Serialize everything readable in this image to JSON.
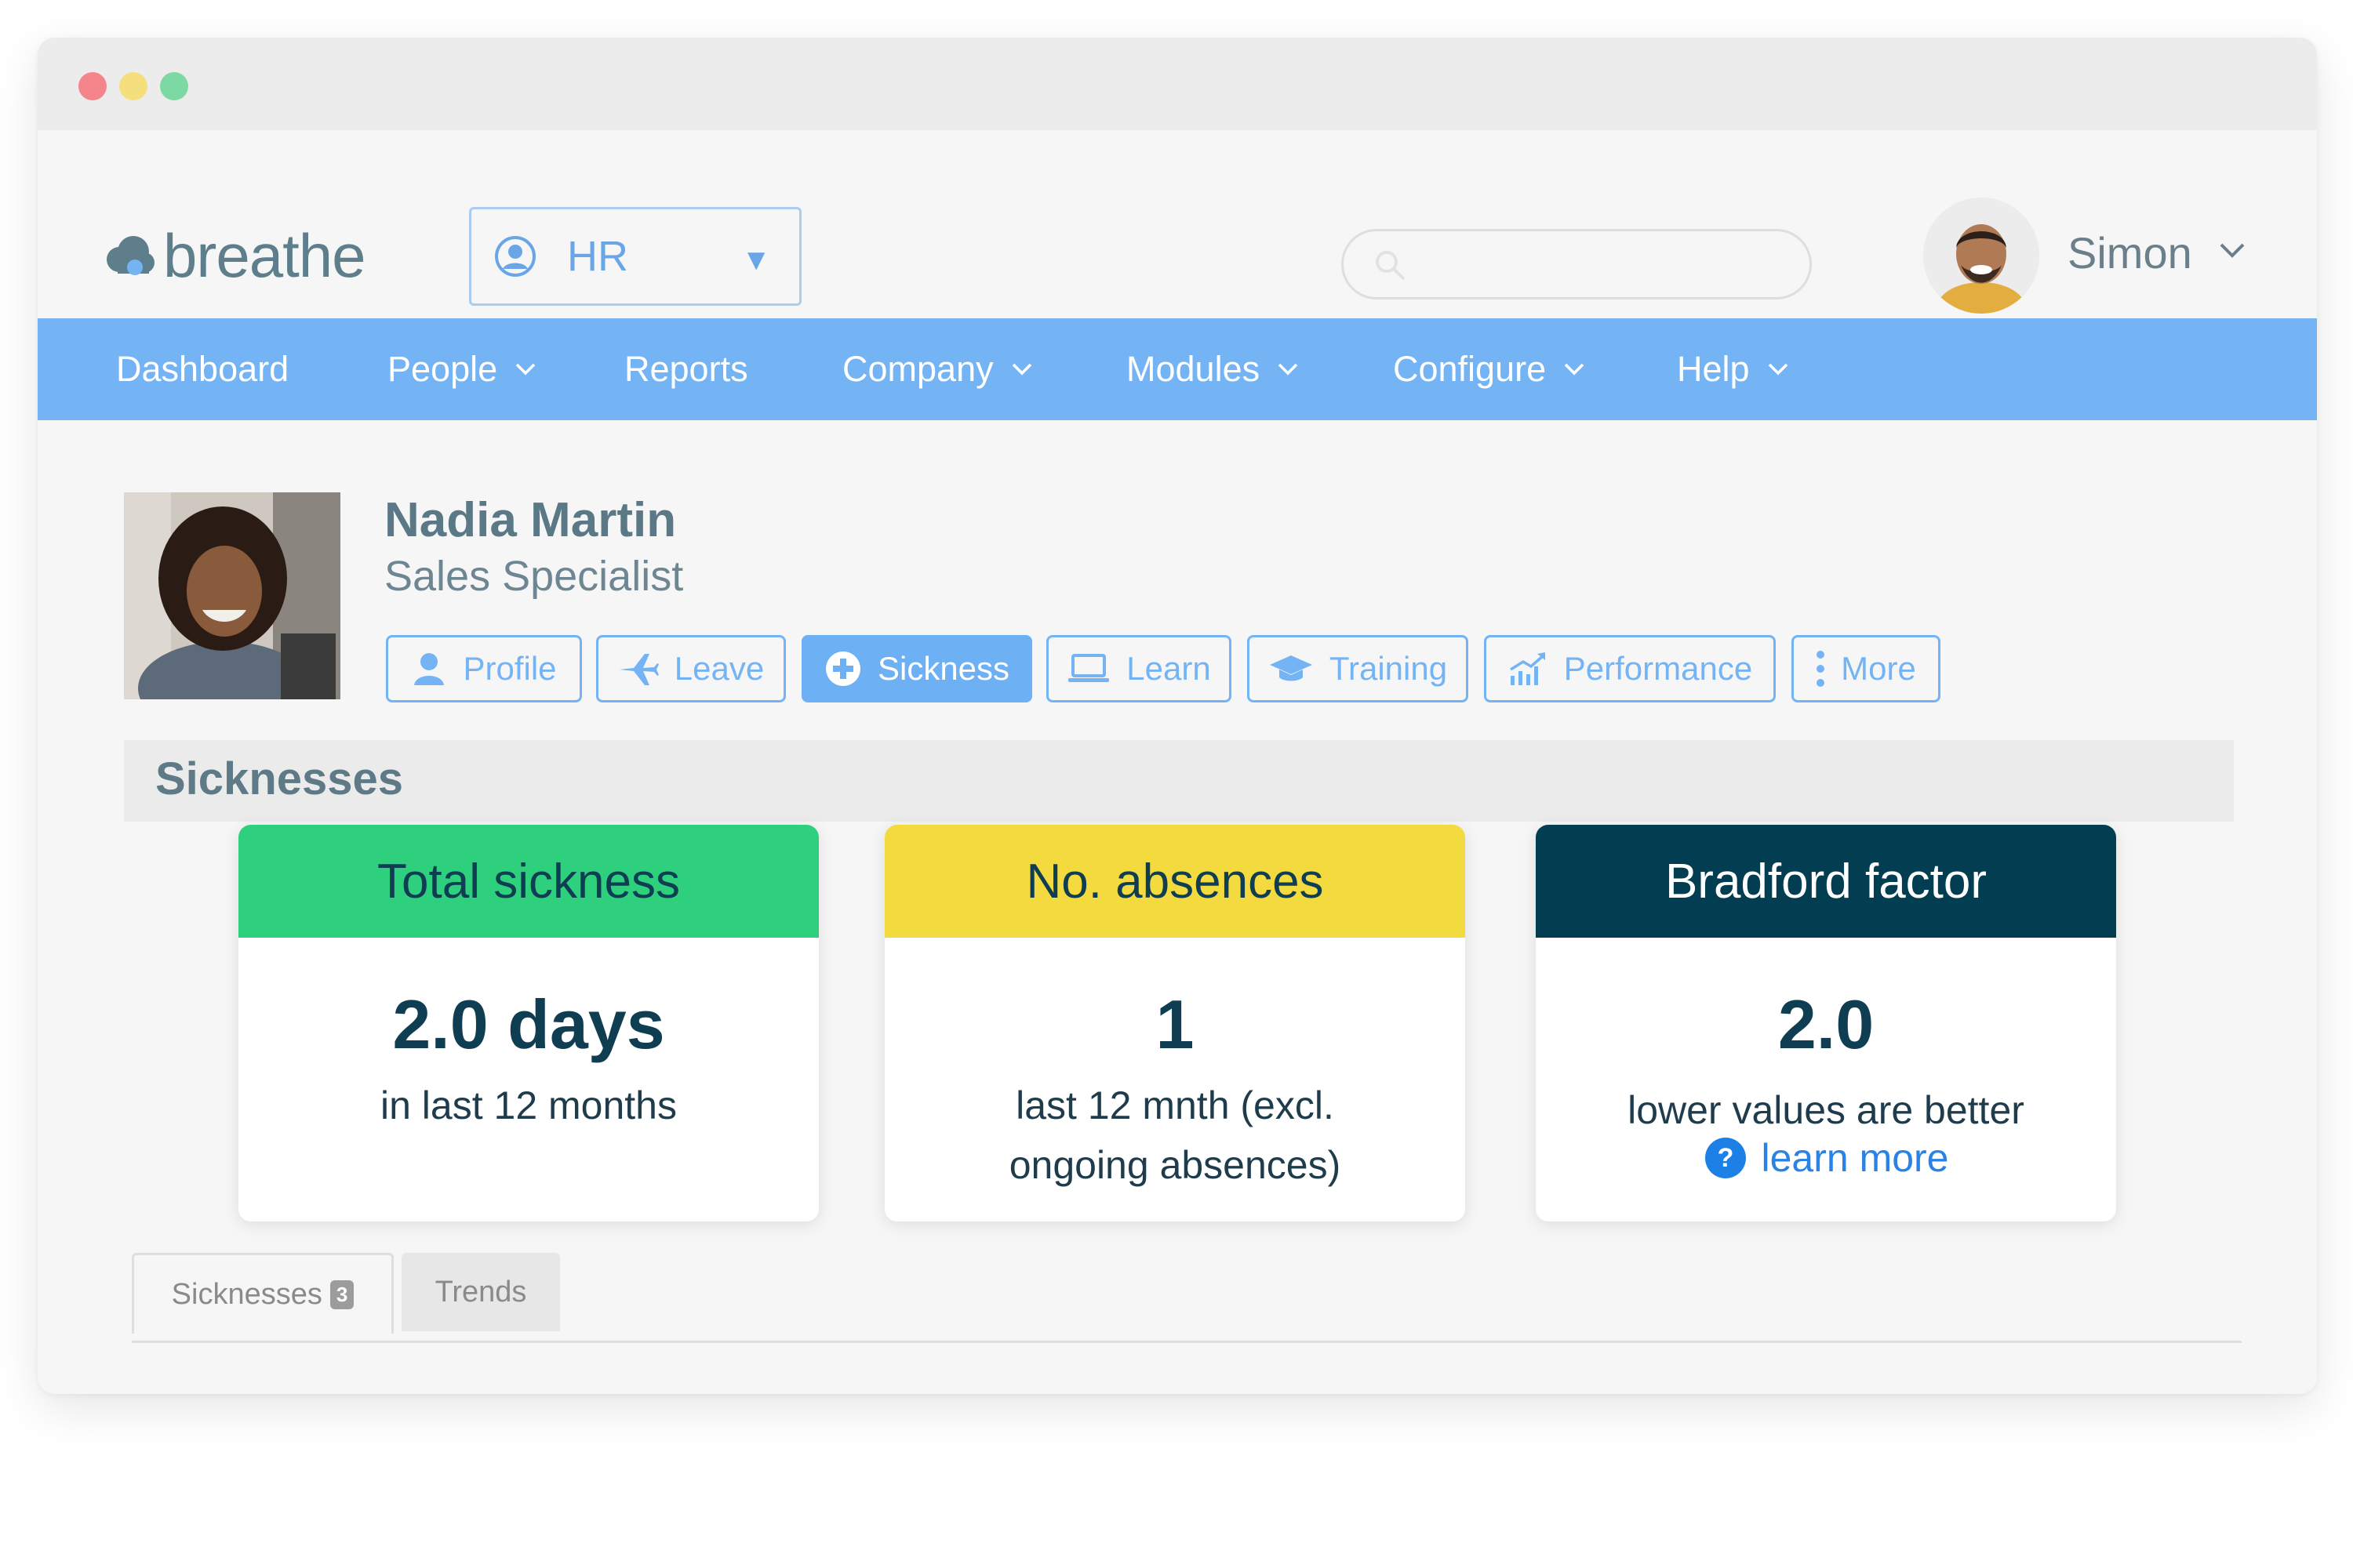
{
  "app": {
    "brand": "breathe",
    "colors": {
      "brand_blue": "#74b4f4",
      "green": "#2ecf7d",
      "yellow": "#f3db3f",
      "navy": "#033d52"
    }
  },
  "header": {
    "department": {
      "selected": "HR",
      "icon": "user-circle-icon"
    },
    "search": {
      "placeholder": "",
      "value": "",
      "icon": "search-icon"
    },
    "user": {
      "name": "Simon"
    }
  },
  "nav": {
    "items": [
      {
        "label": "Dashboard",
        "has_menu": false
      },
      {
        "label": "People",
        "has_menu": true
      },
      {
        "label": "Reports",
        "has_menu": false
      },
      {
        "label": "Company",
        "has_menu": true
      },
      {
        "label": "Modules",
        "has_menu": true
      },
      {
        "label": "Configure",
        "has_menu": true
      },
      {
        "label": "Help",
        "has_menu": true
      }
    ]
  },
  "employee": {
    "name": "Nadia Martin",
    "job_title": "Sales Specialist",
    "tabs": [
      {
        "label": "Profile",
        "icon": "user-icon",
        "active": false
      },
      {
        "label": "Leave",
        "icon": "plane-icon",
        "active": false
      },
      {
        "label": "Sickness",
        "icon": "plus-circle-icon",
        "active": true
      },
      {
        "label": "Learn",
        "icon": "laptop-icon",
        "active": false
      },
      {
        "label": "Training",
        "icon": "graduation-cap-icon",
        "active": false
      },
      {
        "label": "Performance",
        "icon": "chart-up-icon",
        "active": false
      },
      {
        "label": "More",
        "icon": "more-vertical-icon",
        "active": false
      }
    ]
  },
  "sickness": {
    "section_title": "Sicknesses",
    "cards": [
      {
        "title": "Total sickness",
        "value": "2.0 days",
        "subtitle": "in last 12 months",
        "color": "#2ecf7d"
      },
      {
        "title": "No. absences",
        "value": "1",
        "subtitle_line1": "last 12 mnth (excl.",
        "subtitle_line2": "ongoing absences)",
        "color": "#f3db3f"
      },
      {
        "title": "Bradford factor",
        "value": "2.0",
        "subtitle": "lower values are better",
        "link": "learn more",
        "color": "#033d52"
      }
    ],
    "tabs": [
      {
        "label": "Sicknesses",
        "count": "3",
        "active": true
      },
      {
        "label": "Trends",
        "active": false
      }
    ]
  }
}
